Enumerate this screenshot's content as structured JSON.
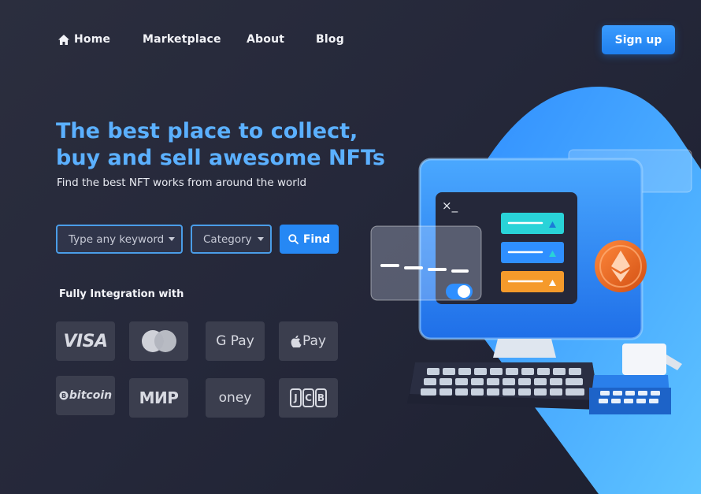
{
  "nav": {
    "home": "Home",
    "marketplace": "Marketplace",
    "about": "About",
    "blog": "Blog",
    "signup": "Sign up"
  },
  "hero": {
    "title": "The best place to collect, buy and sell awesome NFTs",
    "subtitle": "Find the best NFT works from around the world"
  },
  "search": {
    "keyword_placeholder": "Type any keyword",
    "category_label": "Category",
    "find_label": "Find"
  },
  "integration": {
    "title": "Fully Integration with",
    "payments": [
      "VISA",
      "",
      "G Pay",
      "Pay",
      "bitcoin",
      "МИР",
      "oney",
      "JCB"
    ]
  },
  "illustration": {
    "terminal_prompt": "×_"
  },
  "colors": {
    "accent": "#2688f4",
    "title": "#5bb0ff",
    "background": "#272a3b",
    "card": "#3b3e4e",
    "cyan_row": "#29d3d8",
    "orange_row": "#f59a2b",
    "eth_coin": "#ee6a22"
  }
}
